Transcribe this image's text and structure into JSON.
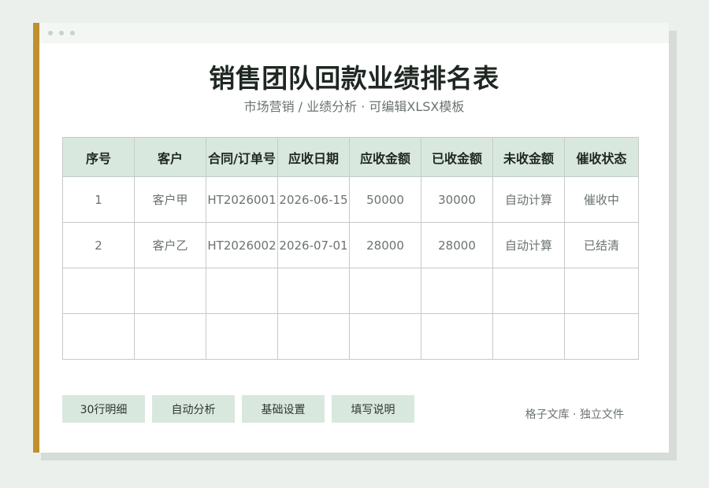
{
  "document": {
    "title": "销售团队回款业绩排名表",
    "subtitle": "市场营销 / 业绩分析 · 可编辑XLSX模板"
  },
  "table": {
    "headers": [
      "序号",
      "客户",
      "合同/订单号",
      "应收日期",
      "应收金额",
      "已收金额",
      "未收金额",
      "催收状态"
    ],
    "rows": [
      [
        "1",
        "客户甲",
        "HT2026001",
        "2026-06-15",
        "50000",
        "30000",
        "自动计算",
        "催收中"
      ],
      [
        "2",
        "客户乙",
        "HT2026002",
        "2026-07-01",
        "28000",
        "28000",
        "自动计算",
        "已结清"
      ],
      [
        "",
        "",
        "",
        "",
        "",
        "",
        "",
        ""
      ],
      [
        "",
        "",
        "",
        "",
        "",
        "",
        "",
        ""
      ]
    ]
  },
  "buttons": {
    "details": "30行明细",
    "analysis": "自动分析",
    "settings": "基础设置",
    "instructions": "填写说明"
  },
  "footer": {
    "text": "格子文库 · 独立文件"
  },
  "colors": {
    "accent": "#c0902e",
    "header_bg": "#d9e8de",
    "page_bg": "#ecf0ec"
  }
}
